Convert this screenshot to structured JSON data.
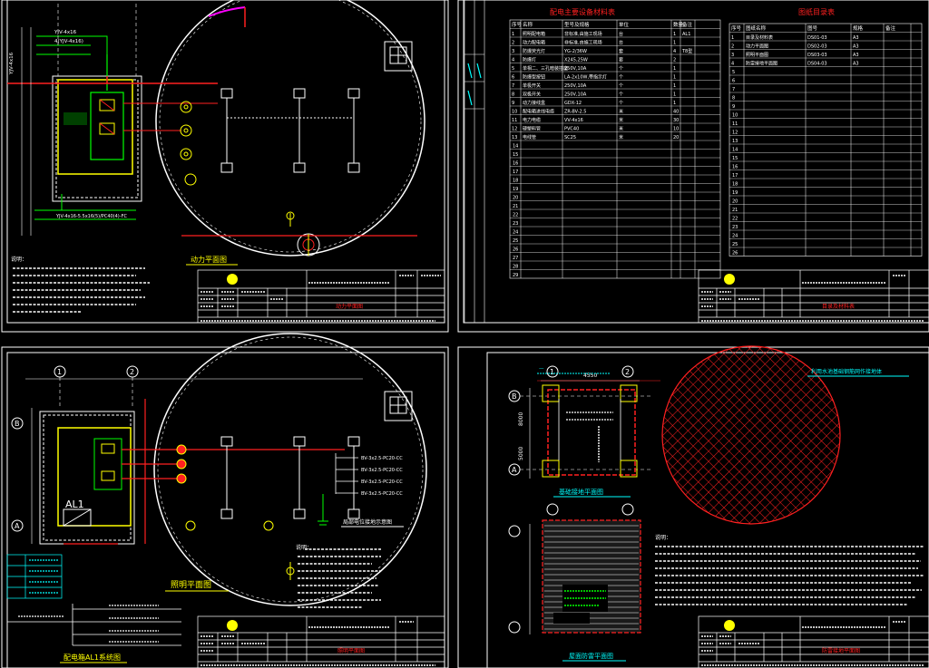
{
  "colors": {
    "background": "#000000",
    "frame": "#ffffff",
    "red": "#ff2020",
    "yellow": "#ffff00",
    "green": "#00ff00",
    "cyan": "#00ffff",
    "magenta": "#ff00ff",
    "blue": "#4060ff"
  },
  "sheet1": {
    "title": "动力平面图",
    "notes_heading": "说明：",
    "note_lines": [
      "1. ……",
      "2. ……",
      "3. ……"
    ],
    "cable_label_1": "YJV-4x16",
    "cable_label_2": "4(YJV-4x16)",
    "riser_label": "YJV-4x16",
    "bottom_cable_label": "YJV-4x16-5.5x16(5)/PC40(4)-FC",
    "tb_main_title": "动力平面图"
  },
  "sheet2": {
    "title_left": "配电主要设备材料表",
    "title_right": "图纸目录表",
    "header_left": [
      "序号",
      "名称",
      "型号及规格",
      "单位",
      "数量",
      "备注"
    ],
    "rows_left": [
      [
        "1",
        "照明配电箱",
        "非标准,由施工现场",
        "台",
        "1",
        "AL1"
      ],
      [
        "2",
        "动力配电箱",
        "非标准,由施工现场",
        "台",
        "1",
        ""
      ],
      [
        "3",
        "防爆荧光灯",
        "YG-2/36W",
        "套",
        "4",
        "T8型"
      ],
      [
        "4",
        "防爆灯",
        "X245,25W",
        "套",
        "2",
        ""
      ],
      [
        "5",
        "单相二、三孔暗装插座",
        "250V,10A",
        "个",
        "1",
        ""
      ],
      [
        "6",
        "防爆型按钮",
        "LA-2x10W,带指示灯",
        "个",
        "1",
        ""
      ],
      [
        "7",
        "单极开关",
        "250V,10A",
        "个",
        "1",
        ""
      ],
      [
        "8",
        "双极开关",
        "250V,10A",
        "个",
        "1",
        ""
      ],
      [
        "9",
        "动力接线盒",
        "GDX-12",
        "个",
        "1",
        ""
      ],
      [
        "10",
        "配电箱进线电缆",
        "ZR-BV-2.5",
        "米",
        "40",
        ""
      ],
      [
        "11",
        "电力电缆",
        "VV-4x16",
        "米",
        "30",
        ""
      ],
      [
        "12",
        "硬塑料管",
        "PVC40",
        "米",
        "10",
        ""
      ],
      [
        "13",
        "电线管",
        "SC25",
        "米",
        "20",
        ""
      ]
    ],
    "header_right": [
      "序号",
      "图纸名称",
      "图号",
      "规格",
      "备注"
    ],
    "rows_right": [
      [
        "1",
        "目录及材料表",
        "DS01-03",
        "A3",
        ""
      ],
      [
        "2",
        "动力平面图",
        "DS02-03",
        "A3",
        ""
      ],
      [
        "3",
        "照明平面图",
        "DS03-03",
        "A3",
        ""
      ],
      [
        "4",
        "防雷接地平面图",
        "DS04-03",
        "A3",
        ""
      ]
    ],
    "tb_main_title": "目录及材料表"
  },
  "sheet3": {
    "title": "照明平面图",
    "panel_label": "AL1",
    "system_title": "配电箱AL1系统图",
    "circuit_labels": [
      "BV-3x2.5-PC20-CC",
      "BV-3x2.5-PC20-CC",
      "BV-3x2.5-PC20-CC",
      "BV-3x2.5-PC20-CC"
    ],
    "detail_title": "局部电位接地示意图",
    "notes_heading": "说明：",
    "tb_main_title": "照明平面图"
  },
  "sheet4": {
    "top_dim": "4550",
    "left_dim_total": "8000",
    "left_dim_part": "5000",
    "plan_title_1": "基础接地平面图",
    "plan_title_2": "屋面防雷平面图",
    "hatch_title": "利用水池基础钢筋网作接地体",
    "notes_heading": "说明：",
    "tb_main_title": "防雷接地平面图"
  },
  "axis_labels": [
    "1",
    "2",
    "A",
    "B"
  ]
}
